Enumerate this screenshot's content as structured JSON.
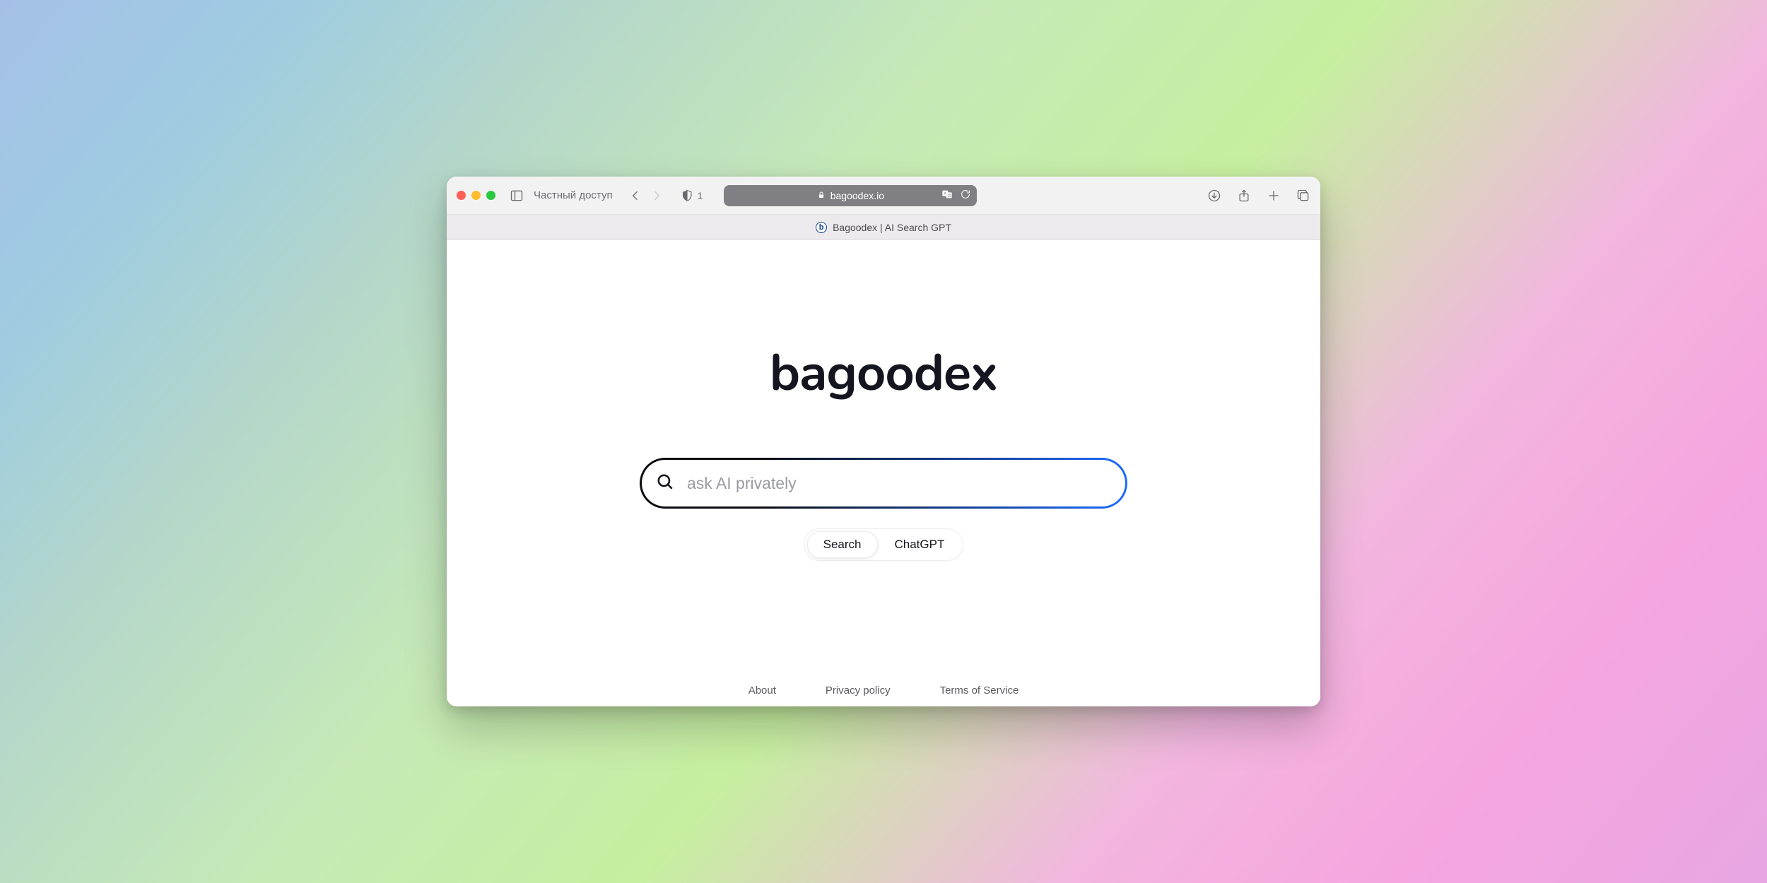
{
  "browser": {
    "private_label": "Частный доступ",
    "shield_count": "1",
    "address": "bagoodex.io",
    "tab_title": "Bagoodex | AI Search GPT",
    "favicon_letter": "b"
  },
  "page": {
    "logo": "bagoodex",
    "search_placeholder": "ask AI privately",
    "segments": {
      "search": "Search",
      "chatgpt": "ChatGPT"
    },
    "footer": {
      "about": "About",
      "privacy": "Privacy policy",
      "terms": "Terms of Service"
    }
  }
}
